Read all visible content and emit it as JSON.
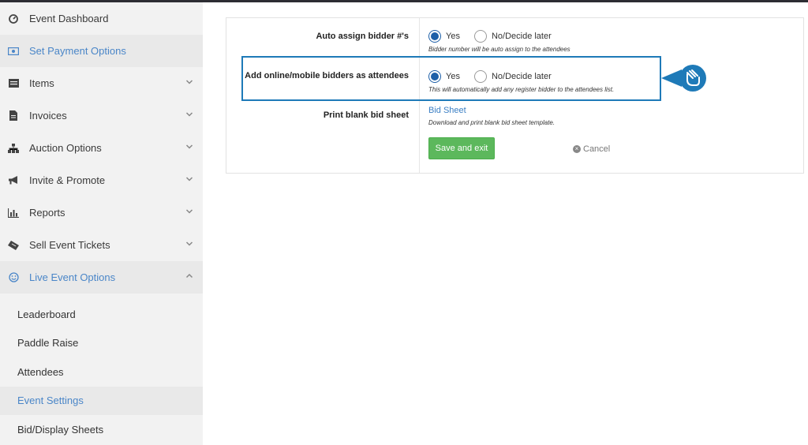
{
  "sidebar": {
    "items": [
      {
        "label": "Event Dashboard",
        "icon": "dashboard-icon",
        "chevron": false,
        "active": false
      },
      {
        "label": "Set Payment Options",
        "icon": "money-icon",
        "chevron": false,
        "active": true
      },
      {
        "label": "Items",
        "icon": "list-icon",
        "chevron": true,
        "active": false
      },
      {
        "label": "Invoices",
        "icon": "document-icon",
        "chevron": true,
        "active": false
      },
      {
        "label": "Auction Options",
        "icon": "sitemap-icon",
        "chevron": true,
        "active": false
      },
      {
        "label": "Invite & Promote",
        "icon": "megaphone-icon",
        "chevron": true,
        "active": false
      },
      {
        "label": "Reports",
        "icon": "bar-chart-icon",
        "chevron": true,
        "active": false
      },
      {
        "label": "Sell Event Tickets",
        "icon": "ticket-icon",
        "chevron": true,
        "active": false
      },
      {
        "label": "Live Event Options",
        "icon": "smile-icon",
        "chevron": true,
        "active": true
      }
    ],
    "subitems": [
      {
        "label": "Leaderboard",
        "active": false
      },
      {
        "label": "Paddle Raise",
        "active": false
      },
      {
        "label": "Attendees",
        "active": false
      },
      {
        "label": "Event Settings",
        "active": true
      },
      {
        "label": "Bid/Display Sheets",
        "active": false
      }
    ]
  },
  "settings": {
    "auto_assign": {
      "label": "Auto assign bidder #'s",
      "yes": "Yes",
      "no": "No/Decide later",
      "selected": "yes",
      "hint": "Bidder number will be auto assign to the attendees"
    },
    "add_online": {
      "label": "Add online/mobile bidders as attendees",
      "yes": "Yes",
      "no": "No/Decide later",
      "selected": "yes",
      "hint": "This will automatically add any register bidder to the attendees list."
    },
    "print_blank": {
      "label": "Print blank bid sheet",
      "link": "Bid Sheet",
      "hint": "Download and print blank bid sheet template."
    },
    "save_label": "Save and exit",
    "cancel_label": "Cancel"
  },
  "colors": {
    "accent": "#4a86c8",
    "radio": "#1d5fa8",
    "save": "#5cb85c",
    "highlight": "#1e7ab8"
  }
}
